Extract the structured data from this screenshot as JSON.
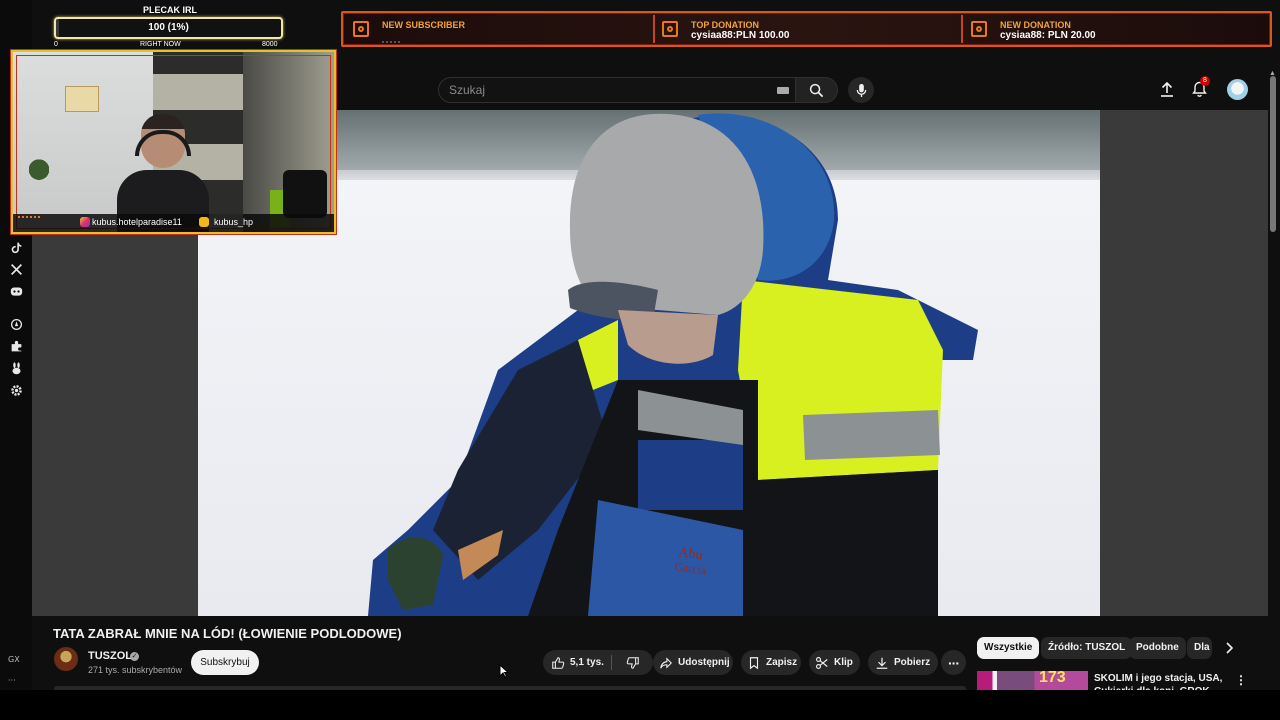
{
  "stream_overlay": {
    "goal": {
      "title": "PLECAK IRL",
      "progress_text": "100 (1%)",
      "progress_fraction": 0.0125,
      "min_label": "0",
      "mid_label": "RIGHT NOW",
      "max_label": "8000"
    },
    "alerts": [
      {
        "label": "NEW SUBSCRIBER",
        "value": ""
      },
      {
        "label": "TOP DONATION",
        "value": "cysiaa88:PLN 100.00"
      },
      {
        "label": "NEW DONATION",
        "value": "cysiaa88: PLN 20.00"
      }
    ],
    "socials": {
      "instagram": "kubus.hotelparadise11",
      "youtube": "kubus_hp"
    },
    "colors": {
      "accent_orange": "#e9781c",
      "frame_red": "#c2321b",
      "frame_yellow": "#e4c22b"
    }
  },
  "browser": {
    "sidebar_icons": [
      "tiktok-icon",
      "x-icon",
      "discord-icon",
      "compass-icon",
      "puzzle-icon",
      "bunny-icon",
      "gear-icon"
    ],
    "sidebar_text": {
      "gx": "GX",
      "more": "···"
    }
  },
  "youtube": {
    "search": {
      "placeholder": "Szukaj",
      "value": ""
    },
    "notifications_count": "8",
    "video": {
      "title": "TATA ZABRAŁ MNIE NA LÓD! (ŁOWIENIE PODLODOWE)",
      "channel": "TUSZOL",
      "subscribers": "271 tys. subskrybentów",
      "subscribe_label": "Subskrybuj"
    },
    "actions": {
      "likes": "5,1 tys.",
      "share": "Udostępnij",
      "save": "Zapisz",
      "clip": "Klip",
      "download": "Pobierz",
      "more": "···"
    },
    "filter_chips": [
      "Wszystkie",
      "Źródło: TUSZOL",
      "Podobne",
      "Dla"
    ],
    "recommendation": {
      "thumb_number": "173",
      "title": "SKOLIM i jego stacja, USA, Cukierki dla koni, GROK..."
    },
    "colors": {
      "accent_red": "#cc0000",
      "chip_active": "#f1f1f1"
    }
  }
}
